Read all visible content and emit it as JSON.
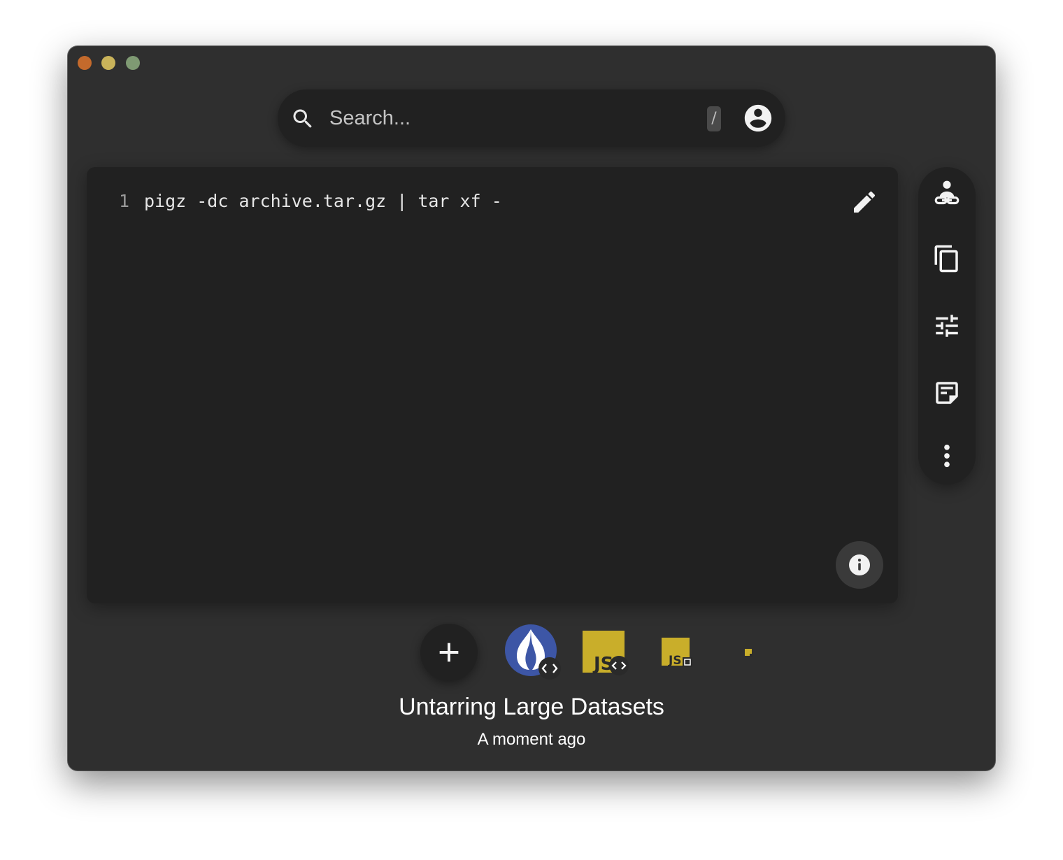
{
  "window": {
    "traffic_lights": [
      "close",
      "minimize",
      "maximize"
    ],
    "colors": {
      "close": "#c46a2c",
      "minimize": "#c9b35a",
      "maximize": "#7f9a73"
    }
  },
  "search": {
    "placeholder": "Search...",
    "shortcut_key": "/",
    "icon": "search-icon",
    "account_icon": "account-circle-icon"
  },
  "editor": {
    "lines": [
      {
        "number": "1",
        "text": "pigz -dc archive.tar.gz | tar xf -"
      }
    ],
    "edit_icon": "pencil-icon",
    "info_icon": "info-icon"
  },
  "side_rail": {
    "items": [
      {
        "name": "share-link",
        "icon": "person-link-icon"
      },
      {
        "name": "copy",
        "icon": "copy-icon"
      },
      {
        "name": "settings",
        "icon": "tune-icon"
      },
      {
        "name": "notes",
        "icon": "sticky-note-icon"
      },
      {
        "name": "more",
        "icon": "more-vertical-icon"
      }
    ]
  },
  "bottom_bar": {
    "add_icon": "plus-icon",
    "languages": [
      {
        "name": "perl",
        "icon": "perl-onion-icon",
        "badge": "code-icon"
      },
      {
        "name": "javascript",
        "icon": "js-icon",
        "badge": "code-icon"
      },
      {
        "name": "javascript-small",
        "icon": "js-icon",
        "badge": "dom-icon"
      },
      {
        "name": "javascript-tiny",
        "icon": "js-icon"
      }
    ],
    "colors": {
      "js_yellow": "#c9ae2a",
      "perl_blue": "#3d56a6"
    }
  },
  "snippet": {
    "title": "Untarring Large Datasets",
    "time": "A moment ago"
  }
}
